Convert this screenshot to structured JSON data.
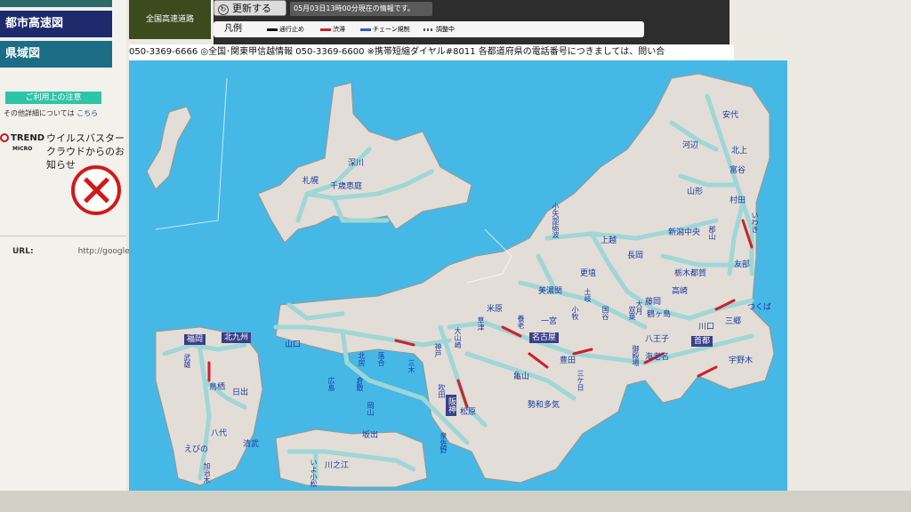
{
  "sidebar": {
    "tab1_label": "都市高速図",
    "tab2_label": "県域図",
    "notice_title": "ご利用上の注意",
    "notice_text": "その他詳細については",
    "notice_link": "こちら",
    "brand_text": "TREND",
    "brand_sub": "MICRO",
    "virus_text": "ウイルスバスター クラウドからのお知らせ",
    "url_label": "URL:",
    "url_value": "http://googles"
  },
  "header": {
    "region_label": "全国高速道路",
    "update_button": "更新する",
    "update_info": "05月03日13時00分現在の情報です。",
    "legend_title": "凡例",
    "legend_items": [
      {
        "label": "通行止め",
        "color": "#111111"
      },
      {
        "label": "渋滞",
        "color": "#d0202a"
      },
      {
        "label": "チェーン規制",
        "color": "#2a5fc8"
      },
      {
        "label": "調整中",
        "color": "#555555"
      }
    ],
    "ticker": "050-3369-6666 ◎全国･関東甲信越情報 050-3369-6600 ※携帯短縮ダイヤル#8011 各都道府県の電話番号につきましては、問い合"
  },
  "map": {
    "labels": [
      "安代",
      "河辺",
      "北上",
      "富谷",
      "山形",
      "村田",
      "いわき",
      "深川",
      "札幌",
      "千歳恵庭",
      "上越",
      "長岡",
      "新潟中央",
      "郡山",
      "更埴",
      "栃木都賀",
      "友部",
      "美濃関",
      "高崎",
      "藤岡",
      "鶴ヶ島",
      "つくば",
      "土岐",
      "大月",
      "川口",
      "三郷",
      "米原",
      "養老",
      "一宮",
      "小牧",
      "八王子",
      "草津",
      "大山崎",
      "豊田",
      "御殿場",
      "海老名",
      "宇野木",
      "山口",
      "北房",
      "落合",
      "三木",
      "神戸",
      "吹田",
      "亀山",
      "勢和多気",
      "松原",
      "泉佐野",
      "広島",
      "倉敷",
      "岡山",
      "坂出",
      "鳥栖",
      "日出",
      "武雄",
      "八代",
      "えびの",
      "清武",
      "加治木",
      "川之江",
      "いよ小松",
      "国谷",
      "双葉",
      "三ケ日",
      "小矢部砺波"
    ],
    "city_labels": [
      "福岡",
      "北九州",
      "名古屋",
      "首都",
      "阪神"
    ],
    "colors": {
      "sea": "#45b8e6",
      "land": "#e2ddd6",
      "road": "#9fd6d6",
      "jam": "#d0202a"
    }
  }
}
